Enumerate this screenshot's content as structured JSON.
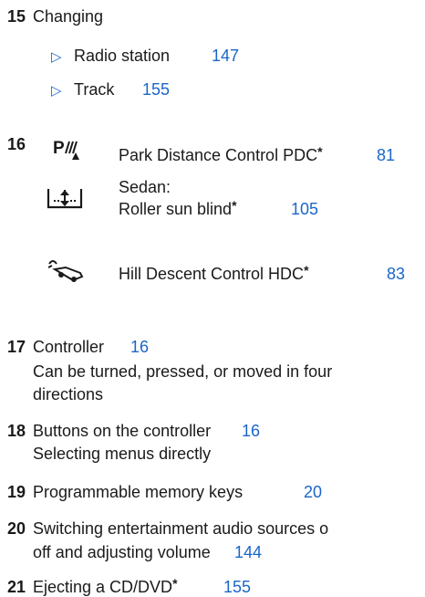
{
  "item15": {
    "num": "15",
    "title": "Changing",
    "bullet_glyph": "▷",
    "subs": [
      {
        "label": "Radio station",
        "page": "147"
      },
      {
        "label": "Track",
        "page": "155"
      }
    ]
  },
  "item16": {
    "num": "16",
    "entries": [
      {
        "icon": "park-distance-control-icon",
        "text": "Park Distance Control PDC",
        "star": "*",
        "page": "81"
      },
      {
        "icon": "roller-sun-blind-icon",
        "prefix": "Sedan:",
        "text": "Roller sun blind",
        "star": "*",
        "page": "105"
      },
      {
        "icon": "hill-descent-control-icon",
        "text": "Hill Descent Control HDC",
        "star": "*",
        "page": "83"
      }
    ]
  },
  "item17": {
    "num": "17",
    "title": "Controller",
    "page": "16",
    "desc1": "Can be turned, pressed, or moved in four",
    "desc2": "directions"
  },
  "item18": {
    "num": "18",
    "title": "Buttons on the controller",
    "page": "16",
    "desc": "Selecting menus directly"
  },
  "item19": {
    "num": "19",
    "title": "Programmable memory keys",
    "page": "20"
  },
  "item20": {
    "num": "20",
    "line1": "Switching entertainment audio sources o",
    "line2": "off and adjusting volume",
    "page": "144"
  },
  "item21": {
    "num": "21",
    "title": "Ejecting a CD/DVD",
    "star": "*",
    "page": "155"
  },
  "colors": {
    "text": "#1a1a1a",
    "link": "#1a66c9"
  }
}
